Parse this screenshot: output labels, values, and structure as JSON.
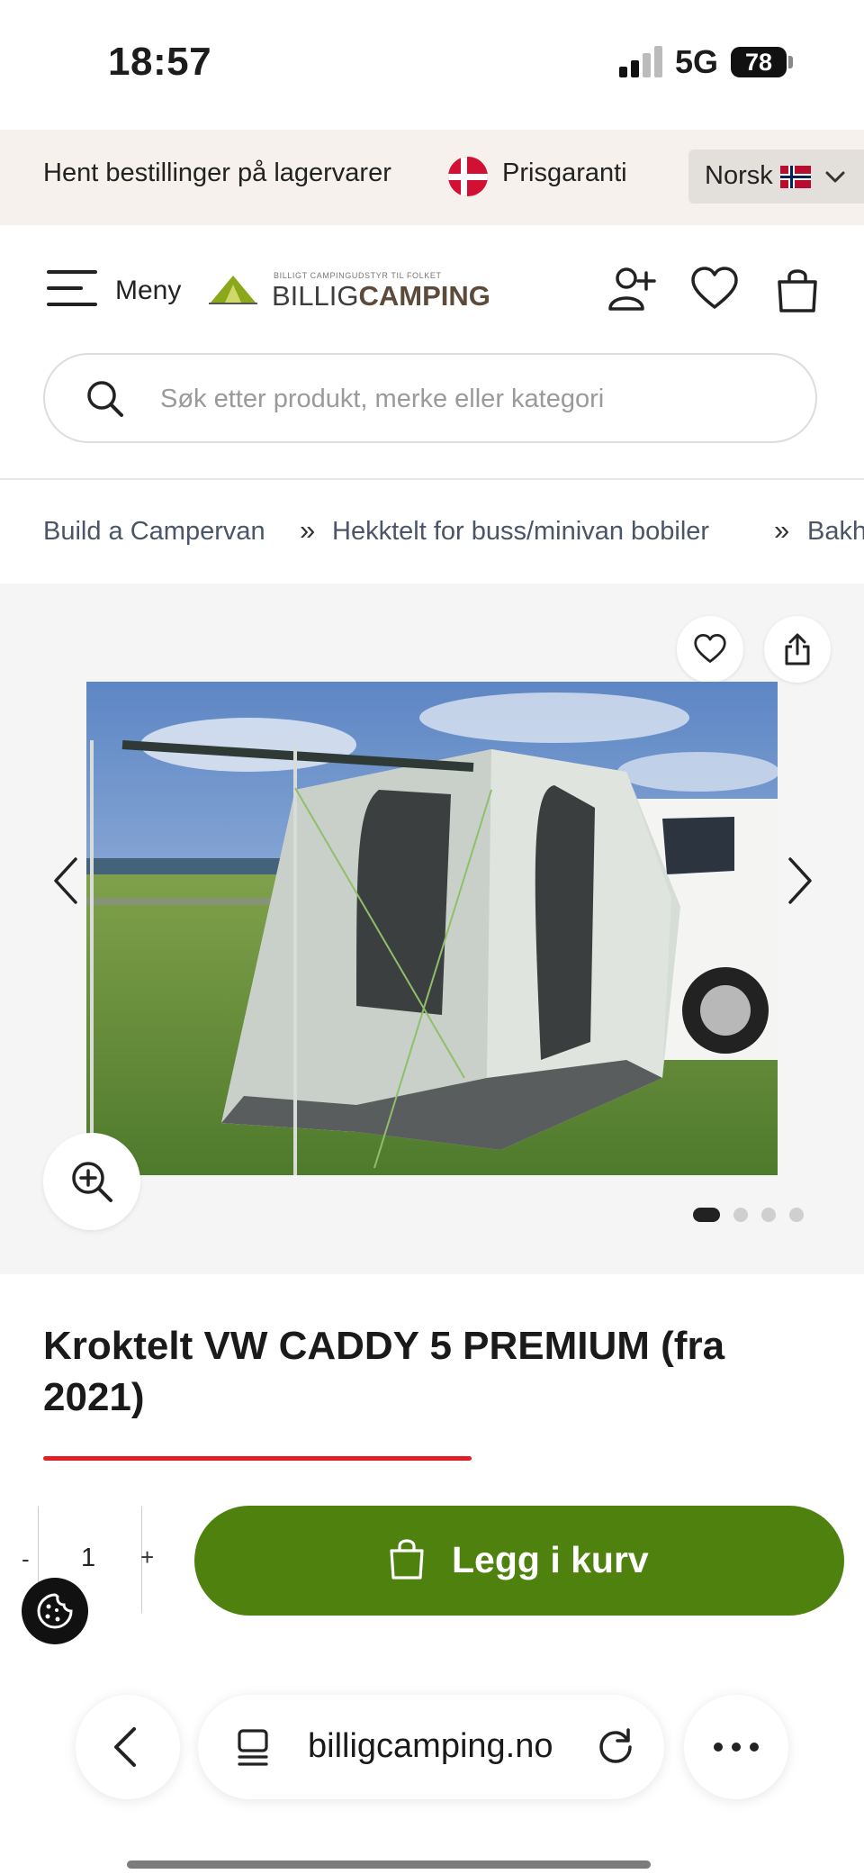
{
  "status_bar": {
    "time": "18:57",
    "network": "5G",
    "battery": "78"
  },
  "promo_bar": {
    "pickup_text": "Hent bestillinger på lagervarer",
    "price_guarantee": "Prisgaranti",
    "language": "Norsk"
  },
  "header": {
    "menu_label": "Meny",
    "logo_tagline": "BILLIGT CAMPINGUDSTYR TIL FOLKET",
    "logo_part1": "BILLIG",
    "logo_part2": "CAMPING",
    "icons": [
      "add-user-icon",
      "heart-icon",
      "shopping-bag-icon"
    ]
  },
  "search": {
    "placeholder": "Søk etter produkt, merke eller kategori"
  },
  "breadcrumb": {
    "items": [
      "Build a Campervan",
      "Hekktelt for buss/minivan bobiler",
      "Bakh"
    ],
    "separator": "»"
  },
  "gallery": {
    "image_count": 4,
    "active_index": 0
  },
  "product": {
    "title": "Kroktelt VW CADDY 5 PREMIUM (fra 2021)",
    "quantity": "1",
    "minus_label": "-",
    "plus_label": "+",
    "add_to_cart_label": "Legg i kurv"
  },
  "browser": {
    "url": "billigcamping.no"
  },
  "colors": {
    "accent_green": "#4f810e",
    "promo_bg": "#f6f1ec",
    "sale_red": "#e31e24"
  }
}
